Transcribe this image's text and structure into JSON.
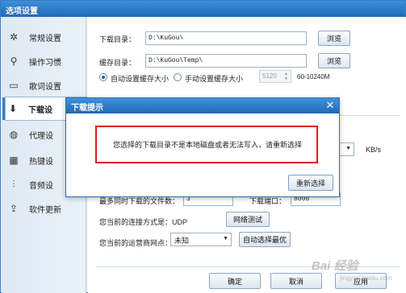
{
  "window": {
    "title": "选项设置"
  },
  "sidebar": {
    "items": [
      {
        "label": "常规设置",
        "icon": "gear-icon",
        "glyph": "✲"
      },
      {
        "label": "操作习惯",
        "icon": "pin-icon",
        "glyph": "⚲"
      },
      {
        "label": "歌词设置",
        "icon": "lyrics-icon",
        "glyph": "▭"
      },
      {
        "label": "下载设",
        "icon": "download-icon",
        "glyph": "⬇"
      },
      {
        "label": "代理设",
        "icon": "globe-icon",
        "glyph": "◍"
      },
      {
        "label": "热键设",
        "icon": "keyboard-icon",
        "glyph": "▦"
      },
      {
        "label": "音频设",
        "icon": "equalizer-icon",
        "glyph": "⫶"
      },
      {
        "label": "软件更新",
        "icon": "upgrade-icon",
        "glyph": "⇪"
      }
    ]
  },
  "download": {
    "dir_label": "下载目录：",
    "dir_value": "D:\\KuGou\\",
    "cache_label": "缓存目录：",
    "cache_value": "D:\\KuGou\\Temp\\",
    "browse_label": "浏览",
    "auto_cache_label": "自动设置缓存大小",
    "manual_cache_label": "手动设置缓存大小",
    "cache_size_value": "5120",
    "cache_range": "60-10240M",
    "speed_unit": "KB/s",
    "max_files_label": "最多同时下载的文件数：",
    "max_files_value": "3",
    "port_label": "下载端口：",
    "port_value": "8000",
    "conn_label": "您当前的连接方式是：UDP",
    "net_test_label": "网络测试",
    "isp_label": "您当前的运营商网点：",
    "isp_value": "未知",
    "auto_select_label": "自动选择最优"
  },
  "footer": {
    "ok": "确定",
    "cancel": "取消",
    "apply": "应用"
  },
  "dialog": {
    "title": "下载提示",
    "message": "您选择的下载目录不是本地磁盘或者无法写入，请重新选择",
    "button": "重新选择"
  },
  "watermark": {
    "text": "Bai 经验",
    "sub": "jingyan.baidu.com"
  },
  "colors": {
    "accent": "#2f7fd0",
    "highlight_border": "#e01b1b",
    "titlebar": "#1f6cb9"
  }
}
